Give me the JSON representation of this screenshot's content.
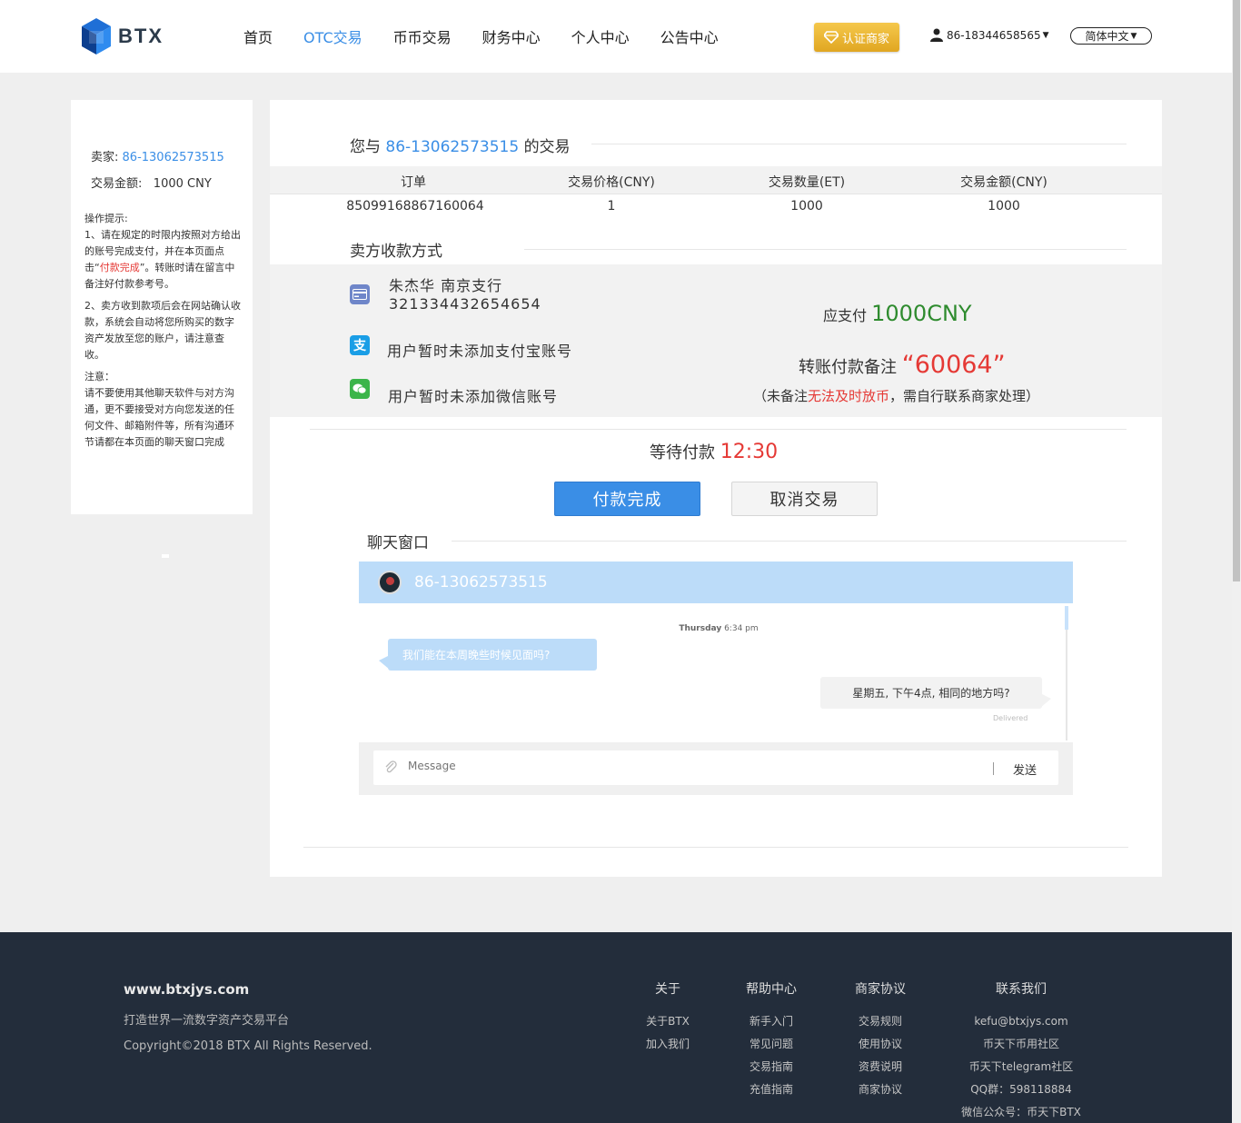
{
  "header": {
    "logo_text": "BTX",
    "nav": [
      {
        "label": "首页",
        "active": false
      },
      {
        "label": "OTC交易",
        "active": true
      },
      {
        "label": "币币交易",
        "active": false
      },
      {
        "label": "财务中心",
        "active": false
      },
      {
        "label": "个人中心",
        "active": false
      },
      {
        "label": "公告中心",
        "active": false
      }
    ],
    "cert_button": "认证商家",
    "user": "86-18344658565",
    "language": "简体中文"
  },
  "left_panel": {
    "seller_label": "卖家:",
    "seller": "86-13062573515",
    "amount_label": "交易金额:",
    "amount": "1000 CNY",
    "tips_title": "操作提示:",
    "tip1_pre": "1、请在规定的时限内按照对方给出的账号完成支付，并在本页面点击“",
    "tip1_red": "付款完成",
    "tip1_post": "”。转账时请在留言中备注好付款参考号。",
    "tip2": "2、卖方收到款项后会在网站确认收款，系统会自动将您所购买的数字资产发放至您的账户，请注意查收。",
    "note_title": "注意：",
    "note": "请不要使用其他聊天软件与对方沟通，更不要接受对方向您发送的任何文件、邮箱附件等，所有沟通环节请都在本页面的聊天窗口完成"
  },
  "trade": {
    "title_pre": "您与",
    "counterparty": "86-13062573515",
    "title_post": "的交易",
    "columns": [
      "订单",
      "交易价格(CNY)",
      "交易数量(ET)",
      "交易金额(CNY)"
    ],
    "row": [
      "85099168867160064",
      "1",
      "1000",
      "1000"
    ]
  },
  "payment": {
    "section_title": "卖方收款方式",
    "bank_name": "朱杰华 南京支行",
    "bank_account": "321334432654654",
    "alipay": "用户暂时未添加支付宝账号",
    "wechat": "用户暂时未添加微信账号",
    "due_label": "应支付",
    "due_amount": "1000CNY",
    "remark_label": "转账付款备注",
    "remark_code": "“60064”",
    "note_pre": "（未备注",
    "note_red": "无法及时放币",
    "note_post": "，需自行联系商家处理）"
  },
  "status": {
    "waiting_label": "等待付款",
    "countdown": "12:30",
    "confirm_button": "付款完成",
    "cancel_button": "取消交易"
  },
  "chat": {
    "title": "聊天窗口",
    "contact": "86-13062573515",
    "date_day": "Thursday",
    "date_time": "6:34 pm",
    "msg_in": "我们能在本周晚些时候见面吗?",
    "msg_out": "星期五, 下午4点, 相同的地方吗?",
    "delivered": "Delivered",
    "placeholder": "Message",
    "send": "发送"
  },
  "footer": {
    "site": "www.btxjys.com",
    "slogan": "打造世界一流数字资产交易平台",
    "copyright": "Copyright©2018 BTX All Rights Reserved.",
    "columns": [
      {
        "title": "关于",
        "items": [
          "关于BTX",
          "加入我们"
        ]
      },
      {
        "title": "帮助中心",
        "items": [
          "新手入门",
          "常见问题",
          "交易指南",
          "充值指南"
        ]
      },
      {
        "title": "商家协议",
        "items": [
          "交易规则",
          "使用协议",
          "资费说明",
          "商家协议"
        ]
      },
      {
        "title": "联系我们",
        "items": [
          "kefu@btxjys.com",
          "币天下币用社区",
          "币天下telegram社区",
          "QQ群：598118884",
          "微信公众号：币天下BTX"
        ]
      }
    ]
  },
  "colors": {
    "accent": "#3a8ee6",
    "danger": "#e53935",
    "success": "#2e8b2e",
    "gold": "#e8b232",
    "footer": "#232d3b"
  }
}
